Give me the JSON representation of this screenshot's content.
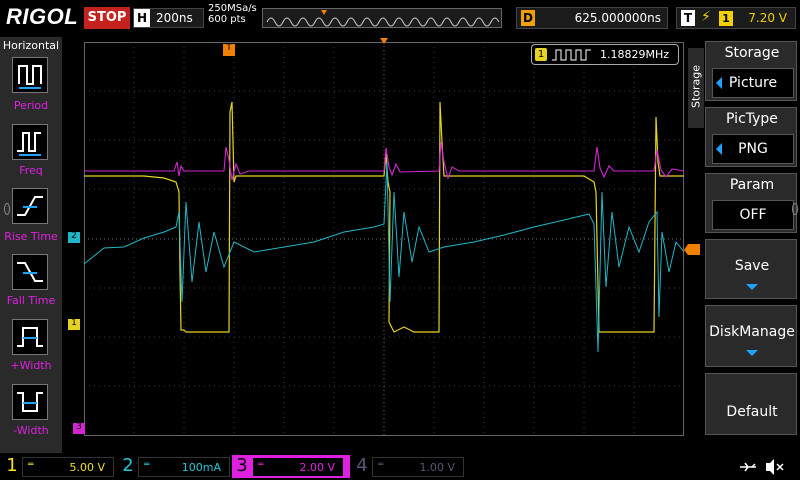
{
  "top": {
    "brand": "RIGOL",
    "run_state": "STOP",
    "horizontal_key": "H",
    "timebase": "200ns",
    "sample_rate": "250MSa/s",
    "memory_depth": "600 pts",
    "delay_key": "D",
    "delay": "625.000000ns",
    "trigger_key": "T",
    "trigger_channel": "1",
    "trigger_level": "7.20 V"
  },
  "left_menu": {
    "title": "Horizontal",
    "items": [
      {
        "label": "Period"
      },
      {
        "label": "Freq"
      },
      {
        "label": "Rise Time"
      },
      {
        "label": "Fall Time"
      },
      {
        "label": "+Width"
      },
      {
        "label": "-Width"
      }
    ]
  },
  "measurement": {
    "channel": "1",
    "value": "1.18829MHz"
  },
  "right_menu": {
    "section": "Storage",
    "header": "Storage",
    "storage_value": "Picture",
    "pictype_label": "PicType",
    "pictype_value": "PNG",
    "param_label": "Param",
    "param_value": "OFF",
    "save_label": "Save",
    "disk_label": "DiskManage",
    "default_label": "Default"
  },
  "markers": {
    "ch2": "2",
    "ch1": "1",
    "trig_t": "T",
    "ch3": "3"
  },
  "channels": [
    {
      "num": "1",
      "scale": "5.00 V",
      "color": "#f0e020"
    },
    {
      "num": "2",
      "scale": "100mA",
      "color": "#20c8d8"
    },
    {
      "num": "3",
      "scale": "2.00 V",
      "color": "#e020e0"
    },
    {
      "num": "4",
      "scale": "1.00 V",
      "color": "#555577"
    }
  ],
  "colors": {
    "ch1": "#e6d320",
    "ch2": "#1fb7c7",
    "ch3": "#d326d3",
    "trigger": "#f08000"
  }
}
